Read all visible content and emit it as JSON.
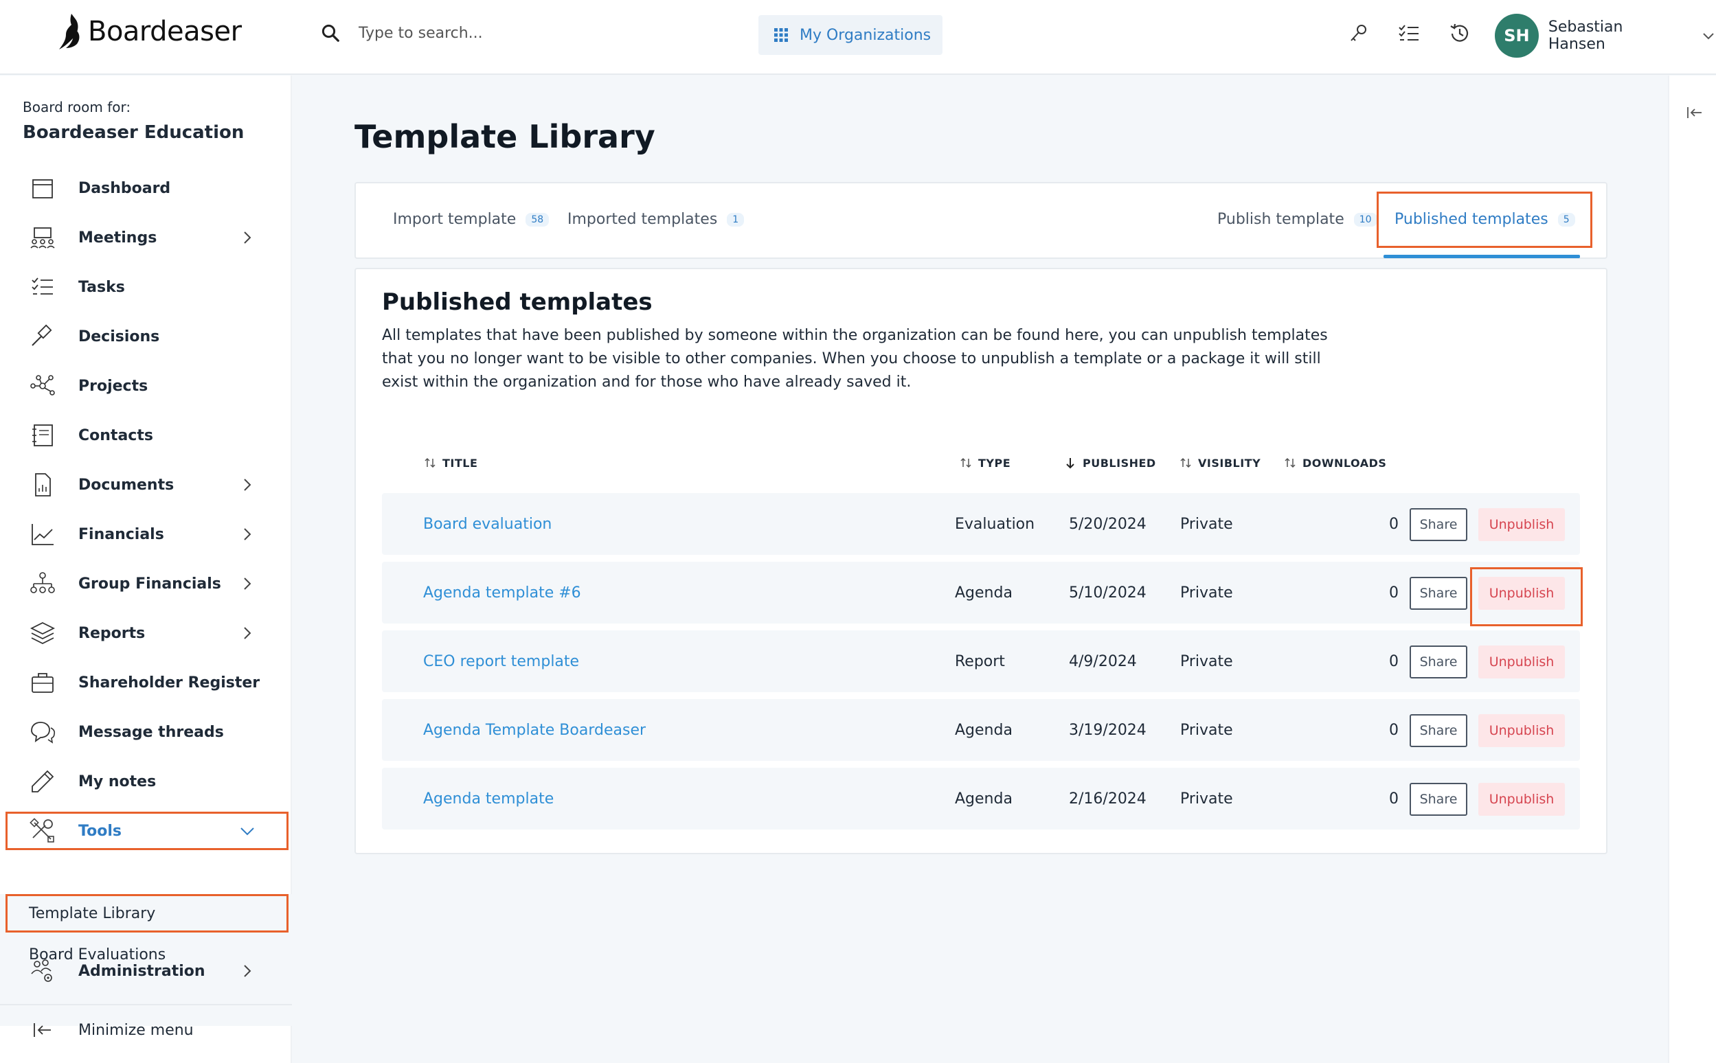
{
  "app": {
    "logo_text": "Boardeaser",
    "search_placeholder": "Type to search...",
    "org_button": "My Organizations",
    "user": {
      "initials": "SH",
      "name": "Sebastian Hansen"
    },
    "top_icons": [
      "key-icon",
      "checklist-icon",
      "history-icon"
    ]
  },
  "sidebar": {
    "room_label": "Board room for:",
    "room_name": "Boardeaser Education",
    "items": [
      {
        "label": "Dashboard",
        "icon": "calendar-icon",
        "has_children": false
      },
      {
        "label": "Meetings",
        "icon": "meetings-icon",
        "has_children": true
      },
      {
        "label": "Tasks",
        "icon": "checklist-icon",
        "has_children": false
      },
      {
        "label": "Decisions",
        "icon": "gavel-icon",
        "has_children": false
      },
      {
        "label": "Projects",
        "icon": "network-icon",
        "has_children": false
      },
      {
        "label": "Contacts",
        "icon": "contacts-icon",
        "has_children": false
      },
      {
        "label": "Documents",
        "icon": "document-icon",
        "has_children": true
      },
      {
        "label": "Financials",
        "icon": "chart-line-icon",
        "has_children": true
      },
      {
        "label": "Group Financials",
        "icon": "org-chart-icon",
        "has_children": true
      },
      {
        "label": "Reports",
        "icon": "layers-icon",
        "has_children": true
      },
      {
        "label": "Shareholder Register",
        "icon": "briefcase-icon",
        "has_children": false
      },
      {
        "label": "Message threads",
        "icon": "chat-icon",
        "has_children": false
      },
      {
        "label": "My notes",
        "icon": "pencil-icon",
        "has_children": false
      },
      {
        "label": "Tools",
        "icon": "tools-icon",
        "has_children": true,
        "expanded": true
      }
    ],
    "tools_sub": [
      {
        "label": "Template Library",
        "active": true
      },
      {
        "label": "Board Evaluations",
        "active": false
      }
    ],
    "administration": "Administration",
    "minimize": "Minimize menu"
  },
  "main": {
    "page_title": "Template Library",
    "tabs": [
      {
        "label": "Import template",
        "count": "58",
        "active": false
      },
      {
        "label": "Imported templates",
        "count": "1",
        "active": false
      },
      {
        "label": "Publish template",
        "count": "10",
        "active": false
      },
      {
        "label": "Published templates",
        "count": "5",
        "active": true
      }
    ],
    "section_title": "Published templates",
    "section_desc": "All templates that have been published by someone within the organization can be found here, you can unpublish templates that you no longer want to be visible to other companies. When you choose to unpublish a template or a package it will still exist within the organization and for those who have already saved it.",
    "columns": [
      "TITLE",
      "TYPE",
      "PUBLISHED",
      "VISIBLITY",
      "DOWNLOADS"
    ],
    "share_label": "Share",
    "unpublish_label": "Unpublish",
    "rows": [
      {
        "title": "Board evaluation",
        "type": "Evaluation",
        "published": "5/20/2024",
        "visibility": "Private",
        "downloads": "0"
      },
      {
        "title": "Agenda template #6",
        "type": "Agenda",
        "published": "5/10/2024",
        "visibility": "Private",
        "downloads": "0"
      },
      {
        "title": "CEO report template",
        "type": "Report",
        "published": "4/9/2024",
        "visibility": "Private",
        "downloads": "0"
      },
      {
        "title": "Agenda Template Boardeaser",
        "type": "Agenda",
        "published": "3/19/2024",
        "visibility": "Private",
        "downloads": "0"
      },
      {
        "title": "Agenda template",
        "type": "Agenda",
        "published": "2/16/2024",
        "visibility": "Private",
        "downloads": "0"
      }
    ]
  },
  "colors": {
    "accent": "#2f8fd6",
    "highlight": "#e8612c",
    "danger": "#d64550",
    "avatar": "#2e7d6b"
  }
}
